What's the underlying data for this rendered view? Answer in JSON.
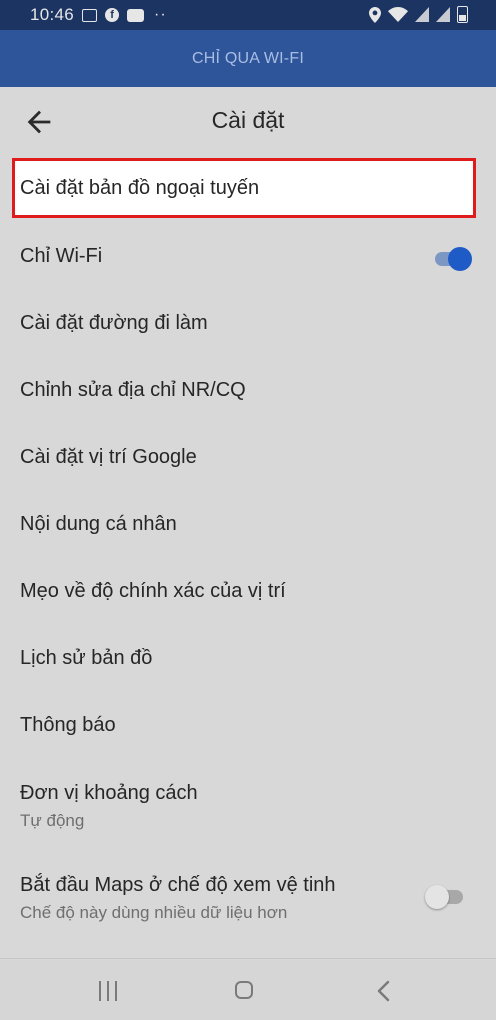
{
  "status_bar": {
    "time": "10:46",
    "left_icons": [
      "image-icon",
      "facebook-icon",
      "badge-icon",
      "more-dots-icon"
    ],
    "right_icons": [
      "location-icon",
      "wifi-icon",
      "signal-icon",
      "signal-icon",
      "battery-icon"
    ]
  },
  "banner": {
    "text": "CHỈ QUA WI-FI"
  },
  "appbar": {
    "title": "Cài đặt",
    "back_icon": "arrow-left-icon"
  },
  "settings": {
    "offline_maps": "Cài đặt bản đồ ngoại tuyến",
    "wifi_only": {
      "label": "Chỉ Wi-Fi",
      "toggle_on": true
    },
    "commute": "Cài đặt đường đi làm",
    "edit_home_work": "Chỉnh sửa địa chỉ NR/CQ",
    "google_location": "Cài đặt vị trí Google",
    "personal_content": "Nội dung cá nhân",
    "location_tips": "Mẹo về độ chính xác của vị trí",
    "maps_history": "Lịch sử bản đồ",
    "notifications": "Thông báo",
    "distance_units": {
      "label": "Đơn vị khoảng cách",
      "value": "Tự động"
    },
    "satellite": {
      "label": "Bắt đầu Maps ở chế độ xem vệ tinh",
      "sub": "Chế độ này dùng nhiều dữ liệu hơn",
      "toggle_on": false
    }
  },
  "colors": {
    "status_bar": "#1c3462",
    "banner": "#2e5599",
    "background": "#d8d8d8",
    "toggle_accent": "#1e5bc6",
    "highlight_border": "#e01b1b"
  }
}
